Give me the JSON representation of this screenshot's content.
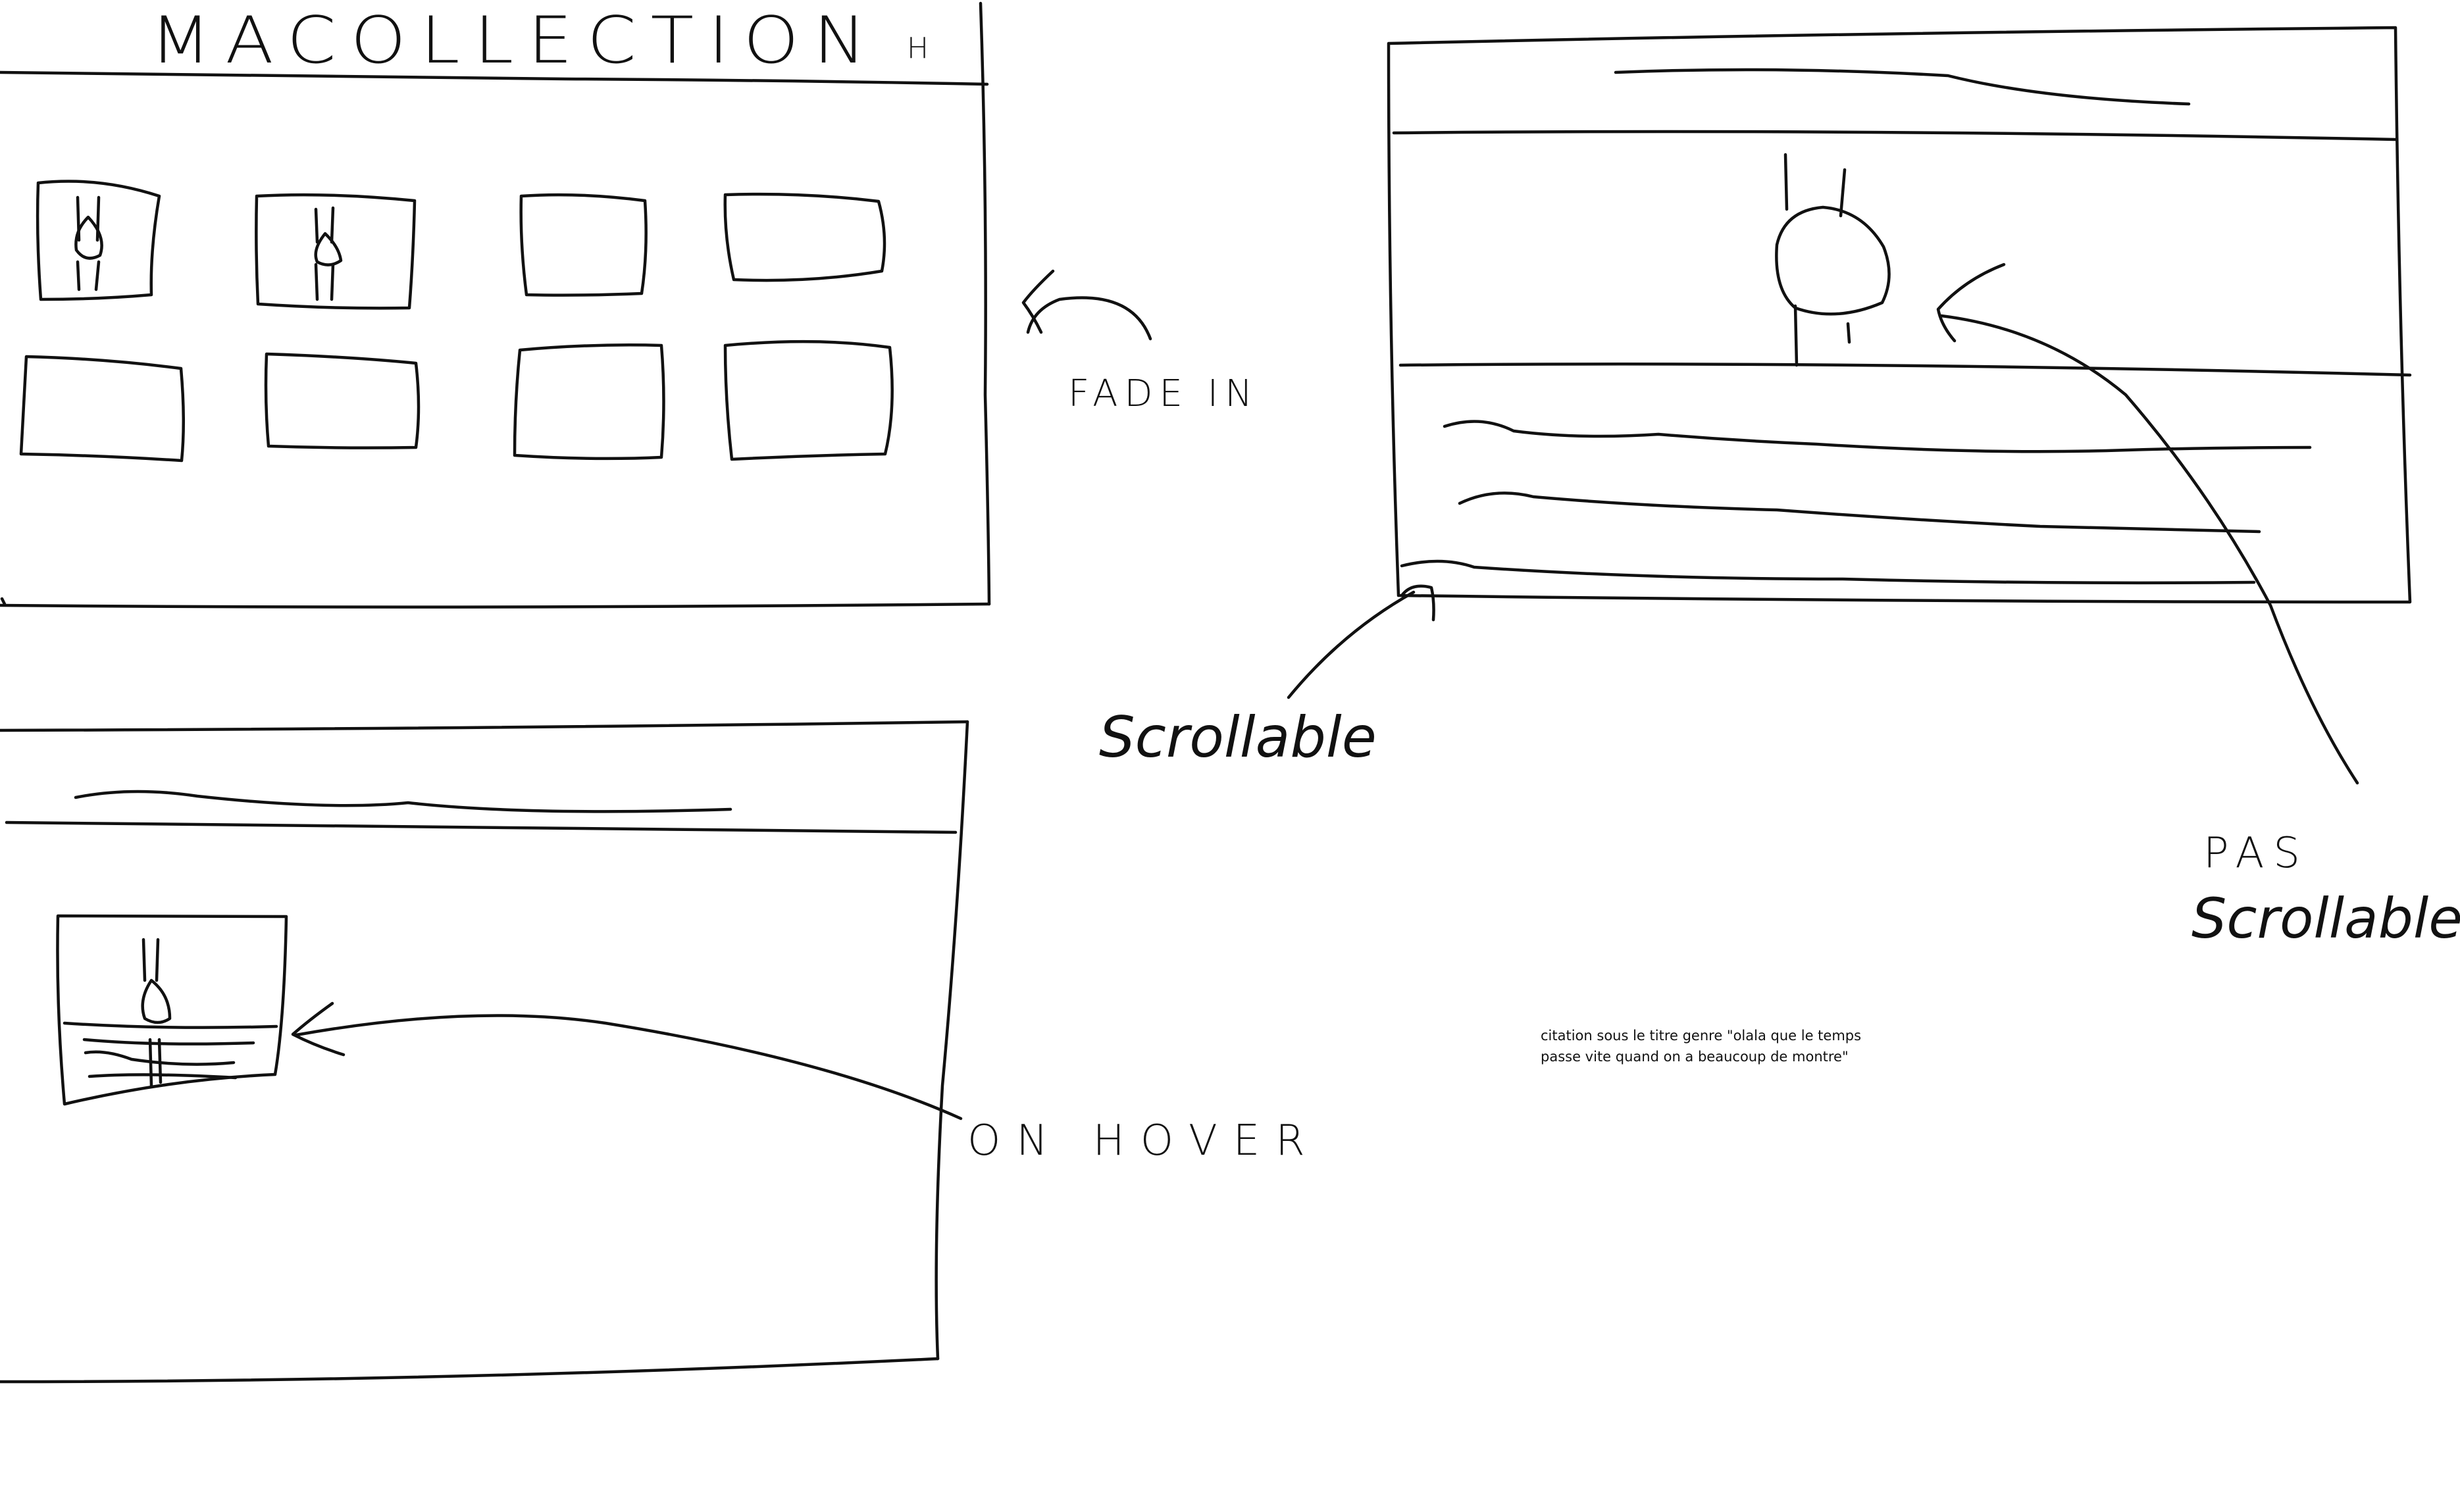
{
  "annotations": {
    "title": "MACOLLECTION",
    "title_mark": "H",
    "fade_in": "FADE IN",
    "scrollable": "Scrollable",
    "not_scrollable_line1": "PAS",
    "not_scrollable_line2": "Scrollable",
    "on_hover": "ON HOVER"
  },
  "note": {
    "line1": "citation sous le titre genre \"olala que le temps",
    "line2": "passe vite quand on a beaucoup de montre\""
  },
  "colors": {
    "ink": "#111111",
    "paper": "#ffffff"
  }
}
